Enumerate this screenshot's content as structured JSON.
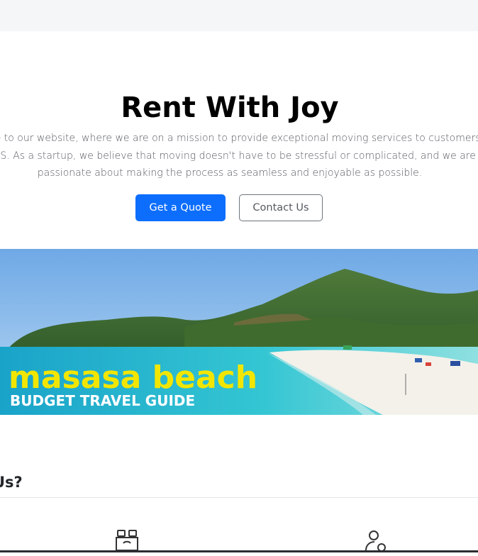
{
  "hero": {
    "title": "Rent With Joy",
    "intro_line_1": "ome to our website, where we are on a mission to provide exceptional moving services to customers",
    "intro_line_2": "e US. As a startup, we believe that moving doesn't have to be stressful or complicated, and we are",
    "intro_line_3": "passionate about making the process as seamless and enjoyable as possible.",
    "primary_button_label": "Get a Quote",
    "secondary_button_label": "Contact Us"
  },
  "banner": {
    "headline": "masasa beach",
    "subheadline": "BUDGET TRAVEL GUIDE"
  },
  "section": {
    "heading": "Us?"
  },
  "icons": {
    "feature_left": "binoculars-icon",
    "feature_right": "user-gear-icon"
  },
  "colors": {
    "primary": "#0d6efd",
    "banner_headline": "#f2e600",
    "banner_subheadline": "#ffffff"
  }
}
